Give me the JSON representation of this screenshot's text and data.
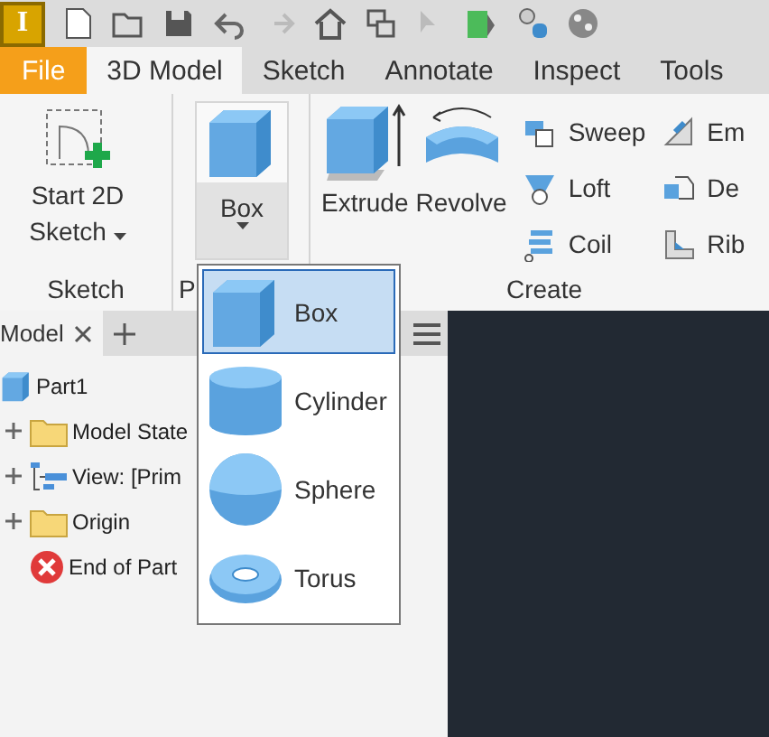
{
  "app": {
    "logo": "I"
  },
  "ribbon_tabs": [
    {
      "label": "File",
      "kind": "file"
    },
    {
      "label": "3D Model",
      "kind": "tab",
      "selected": true
    },
    {
      "label": "Sketch",
      "kind": "tab",
      "selected": false
    },
    {
      "label": "Annotate",
      "kind": "tab",
      "selected": false
    },
    {
      "label": "Inspect",
      "kind": "tab",
      "selected": false
    },
    {
      "label": "Tools",
      "kind": "tab",
      "selected": false
    }
  ],
  "ribbon_groups": [
    {
      "label": "Sketch",
      "tools": [
        {
          "kind": "large",
          "label": "Start 2D Sketch",
          "dropdown": true
        }
      ]
    },
    {
      "label": "P",
      "tools": [
        {
          "kind": "split",
          "label": "Box",
          "dropdown": true,
          "expanded": true
        }
      ]
    },
    {
      "label": "Create",
      "tools": [
        {
          "kind": "large",
          "label": "Extrude",
          "dropdown": false
        },
        {
          "kind": "large",
          "label": "Revolve",
          "dropdown": false
        },
        {
          "kind": "column",
          "items": [
            "Sweep",
            "Loft",
            "Coil"
          ]
        },
        {
          "kind": "column",
          "items": [
            "Em",
            "De",
            "Rib"
          ]
        }
      ]
    }
  ],
  "browser": {
    "tab": "Model",
    "tree": {
      "label": "Part1",
      "children": [
        {
          "label": "Model State",
          "expandable": true
        },
        {
          "label": "View: [Prim",
          "expandable": true
        },
        {
          "label": "Origin",
          "expandable": true
        },
        {
          "label": "End of Part",
          "expandable": false
        }
      ]
    }
  },
  "primitive_menu": [
    {
      "label": "Box",
      "selected": true
    },
    {
      "label": "Cylinder",
      "selected": false
    },
    {
      "label": "Sphere",
      "selected": false
    },
    {
      "label": "Torus",
      "selected": false
    }
  ]
}
